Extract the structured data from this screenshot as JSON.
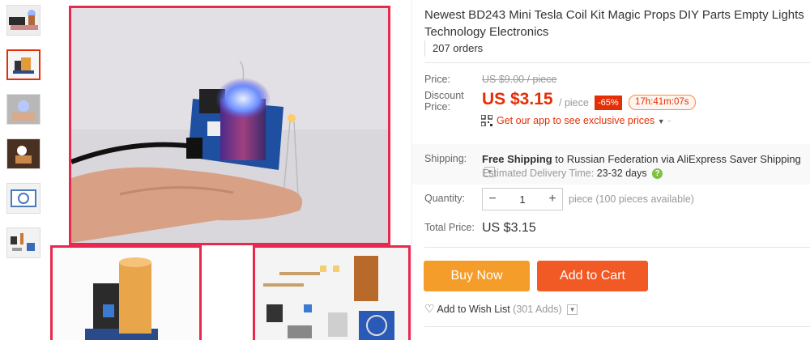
{
  "product": {
    "title": "Newest BD243 Mini Tesla Coil Kit Magic Props DIY Parts Empty Lights Technology Electronics",
    "orders": "207 orders"
  },
  "price": {
    "label": "Price:",
    "original": "US $9.00 / piece",
    "discount_label": "Discount Price:",
    "current": "US $3.15",
    "unit": "/ piece",
    "discount_badge": "-65%",
    "countdown": "17h:41m:07s",
    "app_promo": "Get our app to see exclusive prices"
  },
  "shipping": {
    "label": "Shipping:",
    "free": "Free Shipping",
    "to": "to Russian Federation via AliExpress Saver Shipping",
    "delivery_label": "Estimated Delivery Time:",
    "delivery_days": "23-32",
    "days_word": "days"
  },
  "quantity": {
    "label": "Quantity:",
    "value": "1",
    "minus": "−",
    "plus": "+",
    "available": "piece (100 pieces available)"
  },
  "total": {
    "label": "Total Price:",
    "value": "US $3.15"
  },
  "actions": {
    "buy_now": "Buy Now",
    "add_to_cart": "Add to Cart",
    "wishlist": "Add to Wish List",
    "wishlist_count": "(301 Adds)"
  },
  "colors": {
    "accent": "#e62e04",
    "buy_button": "#f59d2a",
    "cart_button": "#f15a24",
    "photo_border": "#e8284f"
  },
  "icons": [
    "qr-code-icon",
    "chevron-down-icon",
    "help-icon",
    "heart-icon"
  ]
}
